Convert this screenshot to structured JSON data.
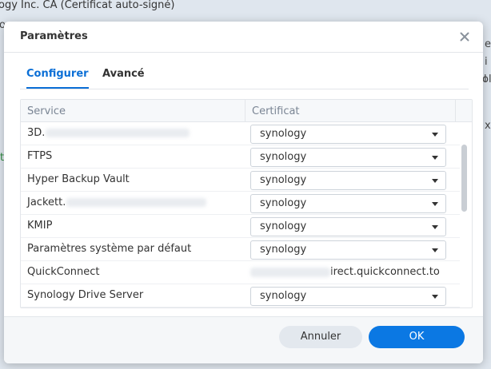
{
  "background": {
    "top_line": "ogy Inc. CA (Certificat auto-signé)",
    "left_fragment": "o",
    "right_fragments": [
      "e",
      "i",
      "l",
      "olo",
      "x"
    ],
    "green_fragment": "t"
  },
  "dialog": {
    "title": "Paramètres",
    "close_icon": "close-icon",
    "tabs": [
      {
        "label": "Configurer",
        "active": true
      },
      {
        "label": "Avancé",
        "active": false
      }
    ],
    "table": {
      "columns": [
        "Service",
        "Certificat"
      ],
      "rows": [
        {
          "service": "3D.",
          "cert": "synology",
          "type": "select"
        },
        {
          "service": "FTPS",
          "cert": "synology",
          "type": "select"
        },
        {
          "service": "Hyper Backup Vault",
          "cert": "synology",
          "type": "select"
        },
        {
          "service": "Jackett.",
          "cert": "synology",
          "type": "select"
        },
        {
          "service": "KMIP",
          "cert": "synology",
          "type": "select"
        },
        {
          "service": "Paramètres système par défaut",
          "cert": "synology",
          "type": "select"
        },
        {
          "service": "QuickConnect",
          "cert": "irect.quickconnect.to",
          "type": "text"
        },
        {
          "service": "Synology Drive Server",
          "cert": "synology",
          "type": "select"
        }
      ]
    },
    "buttons": {
      "cancel": "Annuler",
      "ok": "OK"
    }
  },
  "colors": {
    "accent": "#0b6fd6",
    "ok_button": "#0b78e3"
  }
}
